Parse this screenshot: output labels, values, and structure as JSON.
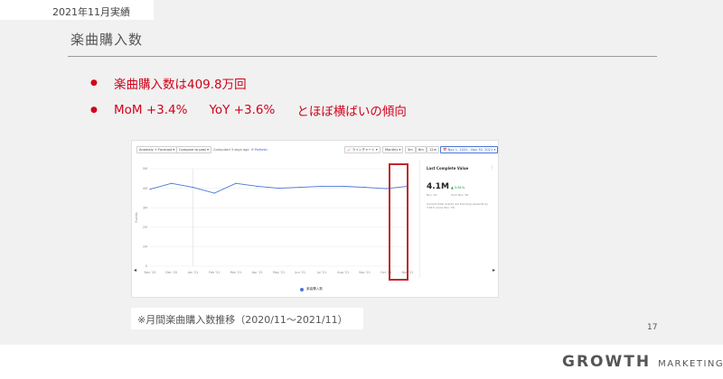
{
  "header": {
    "date_label": "2021年11月実績",
    "title": "楽曲購入数"
  },
  "bullets": [
    {
      "text": "楽曲購入数は409.8万回"
    },
    {
      "mom": "MoM +3.4%",
      "yoy": "YoY +3.6%",
      "trend": "とほぼ横ばいの傾向"
    }
  ],
  "dashboard": {
    "controls": {
      "anomaly": "Anomaly + Forecast ▾",
      "compare": "Compare to past ▾",
      "computed": "Computed 3 days ago",
      "refresh": "⟳ Refresh",
      "chart_type": "📈 ラインチャート ▾",
      "interval": "Monthly ▾",
      "range_3m": "3m",
      "range_6m": "6m",
      "range_12m": "12m",
      "date_range": "📅 Nov 1, 2020 - Nov 30, 2021 ▾"
    },
    "y_axis_label": "Events",
    "side_panel": {
      "title": "Last Complete Value",
      "menu": "⋮",
      "value": "4.1M",
      "change": "▲ 3.61%",
      "sub_period": "Nov '21",
      "sub_compare": "from Nov '20",
      "description": "Current total events are trending upwards by 3.61% since Nov '20."
    },
    "legend": "楽曲購入数",
    "accent": "#4a74d6"
  },
  "chart_data": {
    "type": "line",
    "x": [
      "Nov '20",
      "Dec '20",
      "Jan '21",
      "Feb '21",
      "Mar '21",
      "Apr '21",
      "May '21",
      "Jun '21",
      "Jul '21",
      "Aug '21",
      "Sep '21",
      "Oct '21",
      "Nov '21"
    ],
    "y_ticks": [
      "5M",
      "4M",
      "3M",
      "2M",
      "1M",
      "0"
    ],
    "ylim": [
      0,
      5000000
    ],
    "series": [
      {
        "name": "楽曲購入数",
        "values": [
          3950000,
          4250000,
          4050000,
          3750000,
          4250000,
          4100000,
          4000000,
          4050000,
          4100000,
          4100000,
          4050000,
          3980000,
          4098000
        ]
      }
    ],
    "ylabel": "Events",
    "grid": true,
    "legend": "bottom-center",
    "color": "#4a74d6"
  },
  "caption": "※月間楽曲購入数推移（2020/11〜2021/11）",
  "page_number": "17",
  "logo": {
    "main": "GROWTH",
    "sub": "MARKETING"
  },
  "highlight_color": "#c0282d"
}
